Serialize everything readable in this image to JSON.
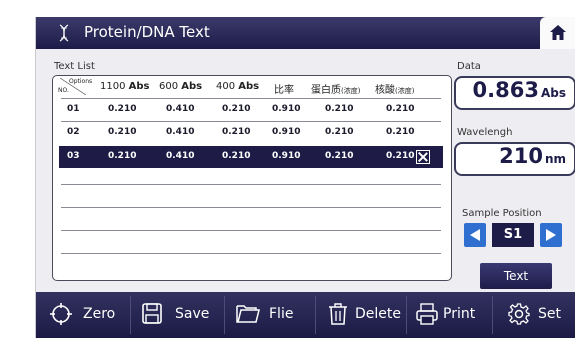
{
  "window": {
    "title": "Protein/DNA Text"
  },
  "text_list": {
    "label": "Text List",
    "header": {
      "options": "Options",
      "no": "NO.",
      "c1": "1100",
      "c1_unit": "Abs",
      "c2": "600",
      "c2_unit": "Abs",
      "c3": "400",
      "c3_unit": "Abs",
      "c4": "比率",
      "c5": "蛋白质",
      "c5_note": "(浓度)",
      "c6": "核酸",
      "c6_note": "(浓度)"
    },
    "rows": [
      {
        "no": "01",
        "v1": "0.210",
        "v2": "0.410",
        "v3": "0.210",
        "v4": "0.910",
        "v5": "0.210",
        "v6": "0.210"
      },
      {
        "no": "02",
        "v1": "0.210",
        "v2": "0.410",
        "v3": "0.210",
        "v4": "0.910",
        "v5": "0.210",
        "v6": "0.210"
      },
      {
        "no": "03",
        "v1": "0.210",
        "v2": "0.410",
        "v3": "0.210",
        "v4": "0.910",
        "v5": "0.210",
        "v6": "0.210"
      }
    ],
    "selected_row": "03"
  },
  "data_panel": {
    "label": "Data",
    "value": "0.863",
    "unit": "Abs"
  },
  "wavelength_panel": {
    "label": "Wavelengh",
    "value": "210",
    "unit": "nm"
  },
  "sample_position": {
    "label": "Sample Position",
    "value": "S1"
  },
  "text_button": {
    "label": "Text"
  },
  "toolbar": {
    "zero": "Zero",
    "save": "Save",
    "file": "Flie",
    "delete": "Delete",
    "print": "Print",
    "set": "Set"
  },
  "icons": [
    "dna-icon",
    "home-icon",
    "zero-icon",
    "save-icon",
    "folder-icon",
    "trash-icon",
    "print-icon",
    "gear-icon"
  ]
}
